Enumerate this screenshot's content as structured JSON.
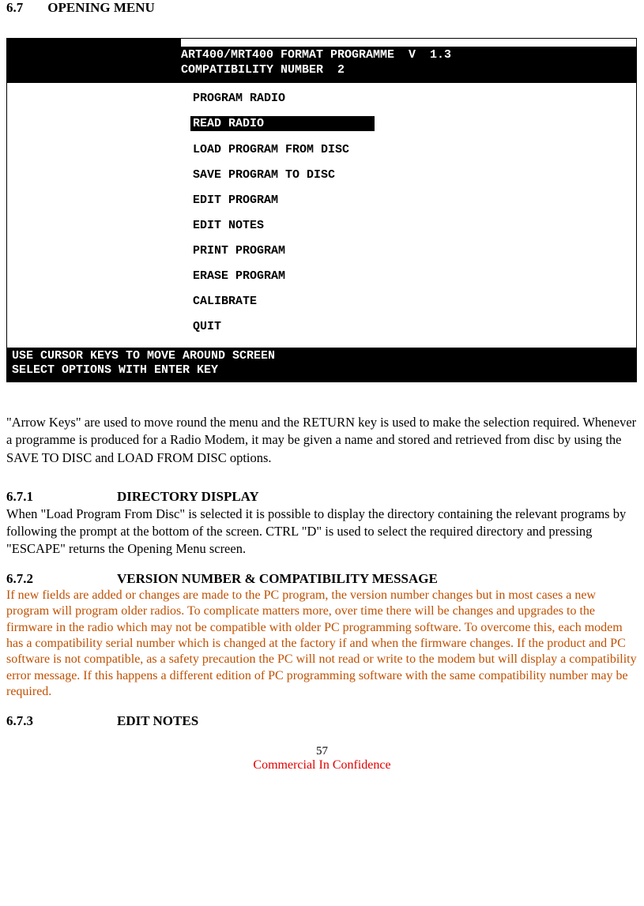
{
  "section": {
    "number": "6.7",
    "title": "OPENING MENU"
  },
  "terminal": {
    "header_line1": "ART400/MRT400 FORMAT PROGRAMME  V  1.3",
    "header_line2": "COMPATIBILITY NUMBER  2",
    "menu_items": [
      "PROGRAM RADIO",
      "READ RADIO",
      "LOAD PROGRAM FROM DISC",
      "SAVE PROGRAM TO DISC",
      "EDIT PROGRAM",
      "EDIT NOTES",
      "PRINT PROGRAM",
      "ERASE PROGRAM",
      "CALIBRATE",
      "QUIT"
    ],
    "selected_index": 1,
    "footer_line1": "USE CURSOR KEYS TO MOVE AROUND SCREEN",
    "footer_line2": "SELECT OPTIONS WITH ENTER KEY"
  },
  "para1": "\"Arrow Keys\" are used to move round the menu and the RETURN key is used to make the  selection required. Whenever  a programme is produced for a Radio Modem,  it may be given a name and stored and retrieved from disc by using the SAVE TO DISC  and LOAD FROM DISC options.",
  "sub1": {
    "number": "6.7.1",
    "title": "DIRECTORY DISPLAY"
  },
  "para2": "When  \"Load Program From Disc\" is selected it is possible to display the directory containing the relevant programs by following the prompt at the bottom of the screen.  CTRL \"D\" is used to select the required directory and pressing  \"ESCAPE\" returns the Opening Menu screen.",
  "sub2": {
    "number": "6.7.2",
    "title": "VERSION NUMBER & COMPATIBILITY MESSAGE"
  },
  "para3": "If new fields are added or changes are made to the PC program,  the version number changes but in most cases a new program will program older radios. To complicate matters more, over time there will be changes and upgrades to the firmware in the radio which may not be compatible with older PC programming software. To overcome this, each modem has a compatibility serial number which is changed at the factory  if and when  the firmware changes. If the product and PC software is not compatible, as a safety precaution the PC will not read or write to the modem but will display a compatibility error message. If this happens a different edition of PC programming software with the same compatibility number may be required.",
  "sub3": {
    "number": "6.7.3",
    "title": "EDIT NOTES"
  },
  "page_number": "57",
  "confidential": "Commercial In Confidence"
}
